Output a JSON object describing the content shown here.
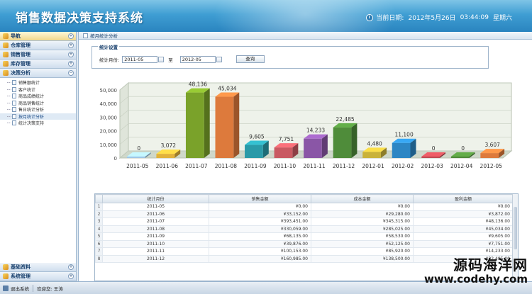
{
  "header": {
    "title": "销售数据决策支持系统",
    "datetime_label": "当前日期:",
    "date": "2012年5月26日",
    "time": "03:44:09",
    "weekday": "星期六"
  },
  "sidebar": {
    "nav_title": "导航",
    "sections": [
      {
        "label": "仓库管理"
      },
      {
        "label": "销售管理"
      },
      {
        "label": "库存管理"
      },
      {
        "label": "决策分析"
      }
    ],
    "tree_items": [
      {
        "label": "销售额统计"
      },
      {
        "label": "客户统计"
      },
      {
        "label": "商品成绩统计"
      },
      {
        "label": "商品销售统计"
      },
      {
        "label": "售日统计分析"
      },
      {
        "label": "按月统计分析"
      },
      {
        "label": "统计决策支持"
      }
    ],
    "bottom_sections": [
      {
        "label": "基础资料"
      },
      {
        "label": "系统管理"
      }
    ]
  },
  "main": {
    "tab_label": "按月统计分析",
    "settings_legend": "统计设置",
    "month_label": "统计月份:",
    "start_value": "2011-05",
    "to_label": "至",
    "end_value": "2012-05",
    "query_label": "查询"
  },
  "chart_data": {
    "type": "bar",
    "categories": [
      "2011-05",
      "2011-06",
      "2011-07",
      "2011-08",
      "2011-09",
      "2011-10",
      "2011-11",
      "2011-12",
      "2012-01",
      "2012-02",
      "2012-03",
      "2012-04",
      "2012-05"
    ],
    "values": [
      0,
      3072,
      48136,
      45034,
      9605,
      7751,
      14233,
      22485,
      4480,
      11100,
      0,
      0,
      3607
    ],
    "value_labels": [
      "0",
      "3,072",
      "48,136",
      "45,034",
      "9,605",
      "7,751",
      "14,233",
      "22,485",
      "4,480",
      "11,100",
      "0",
      "0",
      "3,607"
    ],
    "ylim": [
      0,
      50000
    ],
    "yticks": [
      0,
      10000,
      20000,
      30000,
      40000,
      50000
    ],
    "ytick_labels": [
      "0",
      "10,000",
      "20,000",
      "30,000",
      "40,000",
      "50,000"
    ],
    "colors": [
      "#9ec6e6",
      "#e2b23a",
      "#7aa22a",
      "#dd7a3c",
      "#2a9aa8",
      "#c95a62",
      "#8a56a6",
      "#4f8c3a",
      "#c9b23a",
      "#2c86c4",
      "#c04a52",
      "#4f8a3a",
      "#dd7a3c"
    ],
    "grid": true
  },
  "table": {
    "headers": [
      "统计月份",
      "销售金额",
      "成本金额",
      "盈利金额"
    ],
    "rows": [
      {
        "no": "1",
        "month": "2011-05",
        "sales": "¥0.00",
        "cost": "¥0.00",
        "profit": "¥0.00"
      },
      {
        "no": "2",
        "month": "2011-06",
        "sales": "¥33,152.00",
        "cost": "¥29,280.00",
        "profit": "¥3,872.00"
      },
      {
        "no": "3",
        "month": "2011-07",
        "sales": "¥393,451.00",
        "cost": "¥345,315.00",
        "profit": "¥48,136.00"
      },
      {
        "no": "4",
        "month": "2011-08",
        "sales": "¥330,059.00",
        "cost": "¥285,025.00",
        "profit": "¥45,034.00"
      },
      {
        "no": "5",
        "month": "2011-09",
        "sales": "¥68,135.00",
        "cost": "¥58,530.00",
        "profit": "¥9,605.00"
      },
      {
        "no": "6",
        "month": "2011-10",
        "sales": "¥39,876.00",
        "cost": "¥52,125.00",
        "profit": "¥7,751.00"
      },
      {
        "no": "7",
        "month": "2011-11",
        "sales": "¥100,153.00",
        "cost": "¥85,920.00",
        "profit": "¥14,233.00"
      },
      {
        "no": "8",
        "month": "2011-12",
        "sales": "¥160,985.00",
        "cost": "¥138,500.00",
        "profit": "¥22,485.00"
      }
    ]
  },
  "footer": {
    "logout_label": "退出系统",
    "welcome_label": "欢迎您: 王涛"
  },
  "watermark": {
    "cn": "源码海洋网",
    "url": "www.codehy.com"
  }
}
